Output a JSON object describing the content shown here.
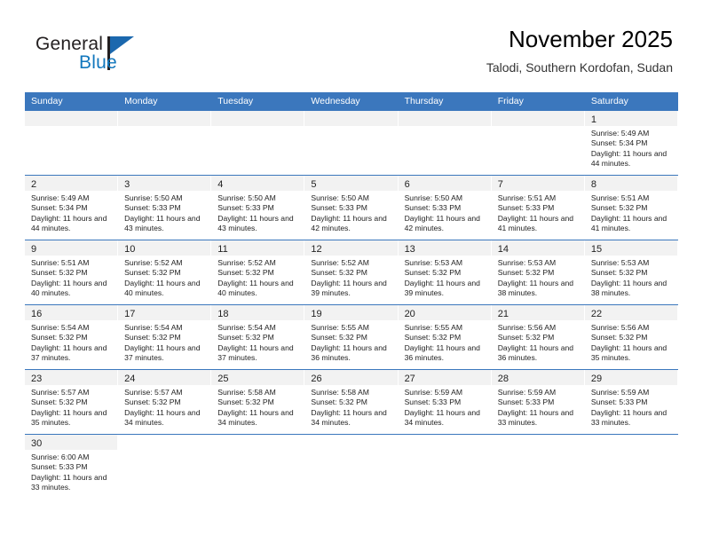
{
  "brand": {
    "name_top": "General",
    "name_bottom": "Blue",
    "triangle_color": "#1b68ae",
    "blue_text_color": "#1277bd"
  },
  "header": {
    "title": "November 2025",
    "subtitle": "Talodi, Southern Kordofan, Sudan"
  },
  "theme": {
    "header_blue": "#3b77bd",
    "day_strip_gray": "#f2f2f2",
    "text_color": "#222222"
  },
  "weekdays": [
    "Sunday",
    "Monday",
    "Tuesday",
    "Wednesday",
    "Thursday",
    "Friday",
    "Saturday"
  ],
  "labels": {
    "sunrise": "Sunrise:",
    "sunset": "Sunset:",
    "daylight": "Daylight:"
  },
  "weeks": [
    [
      {
        "day": "",
        "empty": true
      },
      {
        "day": "",
        "empty": true
      },
      {
        "day": "",
        "empty": true
      },
      {
        "day": "",
        "empty": true
      },
      {
        "day": "",
        "empty": true
      },
      {
        "day": "",
        "empty": true
      },
      {
        "day": "1",
        "sunrise": "Sunrise: 5:49 AM",
        "sunset": "Sunset: 5:34 PM",
        "daylight": "Daylight: 11 hours and 44 minutes."
      }
    ],
    [
      {
        "day": "2",
        "sunrise": "Sunrise: 5:49 AM",
        "sunset": "Sunset: 5:34 PM",
        "daylight": "Daylight: 11 hours and 44 minutes."
      },
      {
        "day": "3",
        "sunrise": "Sunrise: 5:50 AM",
        "sunset": "Sunset: 5:33 PM",
        "daylight": "Daylight: 11 hours and 43 minutes."
      },
      {
        "day": "4",
        "sunrise": "Sunrise: 5:50 AM",
        "sunset": "Sunset: 5:33 PM",
        "daylight": "Daylight: 11 hours and 43 minutes."
      },
      {
        "day": "5",
        "sunrise": "Sunrise: 5:50 AM",
        "sunset": "Sunset: 5:33 PM",
        "daylight": "Daylight: 11 hours and 42 minutes."
      },
      {
        "day": "6",
        "sunrise": "Sunrise: 5:50 AM",
        "sunset": "Sunset: 5:33 PM",
        "daylight": "Daylight: 11 hours and 42 minutes."
      },
      {
        "day": "7",
        "sunrise": "Sunrise: 5:51 AM",
        "sunset": "Sunset: 5:33 PM",
        "daylight": "Daylight: 11 hours and 41 minutes."
      },
      {
        "day": "8",
        "sunrise": "Sunrise: 5:51 AM",
        "sunset": "Sunset: 5:32 PM",
        "daylight": "Daylight: 11 hours and 41 minutes."
      }
    ],
    [
      {
        "day": "9",
        "sunrise": "Sunrise: 5:51 AM",
        "sunset": "Sunset: 5:32 PM",
        "daylight": "Daylight: 11 hours and 40 minutes."
      },
      {
        "day": "10",
        "sunrise": "Sunrise: 5:52 AM",
        "sunset": "Sunset: 5:32 PM",
        "daylight": "Daylight: 11 hours and 40 minutes."
      },
      {
        "day": "11",
        "sunrise": "Sunrise: 5:52 AM",
        "sunset": "Sunset: 5:32 PM",
        "daylight": "Daylight: 11 hours and 40 minutes."
      },
      {
        "day": "12",
        "sunrise": "Sunrise: 5:52 AM",
        "sunset": "Sunset: 5:32 PM",
        "daylight": "Daylight: 11 hours and 39 minutes."
      },
      {
        "day": "13",
        "sunrise": "Sunrise: 5:53 AM",
        "sunset": "Sunset: 5:32 PM",
        "daylight": "Daylight: 11 hours and 39 minutes."
      },
      {
        "day": "14",
        "sunrise": "Sunrise: 5:53 AM",
        "sunset": "Sunset: 5:32 PM",
        "daylight": "Daylight: 11 hours and 38 minutes."
      },
      {
        "day": "15",
        "sunrise": "Sunrise: 5:53 AM",
        "sunset": "Sunset: 5:32 PM",
        "daylight": "Daylight: 11 hours and 38 minutes."
      }
    ],
    [
      {
        "day": "16",
        "sunrise": "Sunrise: 5:54 AM",
        "sunset": "Sunset: 5:32 PM",
        "daylight": "Daylight: 11 hours and 37 minutes."
      },
      {
        "day": "17",
        "sunrise": "Sunrise: 5:54 AM",
        "sunset": "Sunset: 5:32 PM",
        "daylight": "Daylight: 11 hours and 37 minutes."
      },
      {
        "day": "18",
        "sunrise": "Sunrise: 5:54 AM",
        "sunset": "Sunset: 5:32 PM",
        "daylight": "Daylight: 11 hours and 37 minutes."
      },
      {
        "day": "19",
        "sunrise": "Sunrise: 5:55 AM",
        "sunset": "Sunset: 5:32 PM",
        "daylight": "Daylight: 11 hours and 36 minutes."
      },
      {
        "day": "20",
        "sunrise": "Sunrise: 5:55 AM",
        "sunset": "Sunset: 5:32 PM",
        "daylight": "Daylight: 11 hours and 36 minutes."
      },
      {
        "day": "21",
        "sunrise": "Sunrise: 5:56 AM",
        "sunset": "Sunset: 5:32 PM",
        "daylight": "Daylight: 11 hours and 36 minutes."
      },
      {
        "day": "22",
        "sunrise": "Sunrise: 5:56 AM",
        "sunset": "Sunset: 5:32 PM",
        "daylight": "Daylight: 11 hours and 35 minutes."
      }
    ],
    [
      {
        "day": "23",
        "sunrise": "Sunrise: 5:57 AM",
        "sunset": "Sunset: 5:32 PM",
        "daylight": "Daylight: 11 hours and 35 minutes."
      },
      {
        "day": "24",
        "sunrise": "Sunrise: 5:57 AM",
        "sunset": "Sunset: 5:32 PM",
        "daylight": "Daylight: 11 hours and 34 minutes."
      },
      {
        "day": "25",
        "sunrise": "Sunrise: 5:58 AM",
        "sunset": "Sunset: 5:32 PM",
        "daylight": "Daylight: 11 hours and 34 minutes."
      },
      {
        "day": "26",
        "sunrise": "Sunrise: 5:58 AM",
        "sunset": "Sunset: 5:32 PM",
        "daylight": "Daylight: 11 hours and 34 minutes."
      },
      {
        "day": "27",
        "sunrise": "Sunrise: 5:59 AM",
        "sunset": "Sunset: 5:33 PM",
        "daylight": "Daylight: 11 hours and 34 minutes."
      },
      {
        "day": "28",
        "sunrise": "Sunrise: 5:59 AM",
        "sunset": "Sunset: 5:33 PM",
        "daylight": "Daylight: 11 hours and 33 minutes."
      },
      {
        "day": "29",
        "sunrise": "Sunrise: 5:59 AM",
        "sunset": "Sunset: 5:33 PM",
        "daylight": "Daylight: 11 hours and 33 minutes."
      }
    ],
    [
      {
        "day": "30",
        "sunrise": "Sunrise: 6:00 AM",
        "sunset": "Sunset: 5:33 PM",
        "daylight": "Daylight: 11 hours and 33 minutes."
      },
      {
        "day": "",
        "empty": true,
        "blank": true
      },
      {
        "day": "",
        "empty": true,
        "blank": true
      },
      {
        "day": "",
        "empty": true,
        "blank": true
      },
      {
        "day": "",
        "empty": true,
        "blank": true
      },
      {
        "day": "",
        "empty": true,
        "blank": true
      },
      {
        "day": "",
        "empty": true,
        "blank": true
      }
    ]
  ]
}
